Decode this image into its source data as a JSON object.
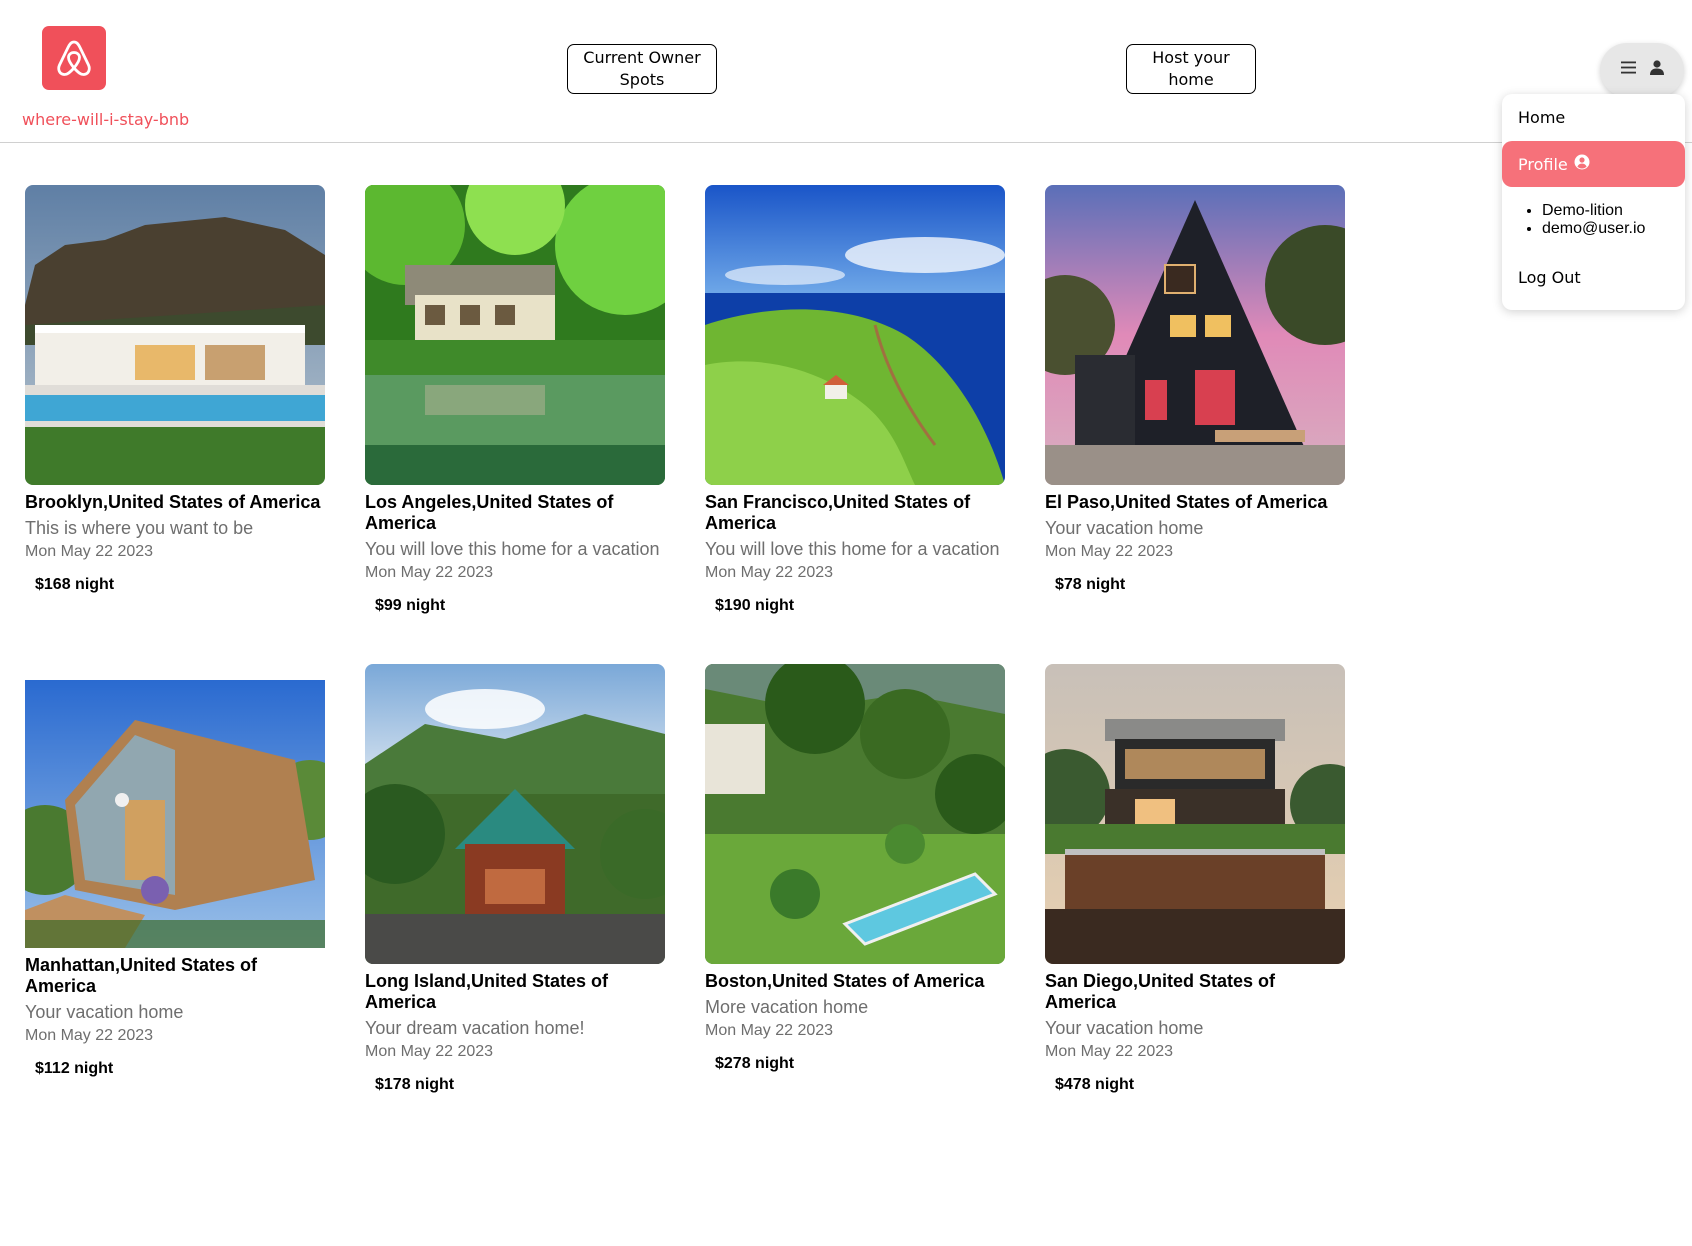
{
  "brand": {
    "site_name": "where-will-i-stay-bnb",
    "logo_icon": "airbnb-belo-icon",
    "accent": "#f0505a"
  },
  "header": {
    "owner_spots_label": "Current Owner Spots",
    "host_label": "Host your home",
    "menu_icon": "hamburger-icon",
    "user_icon": "user-icon"
  },
  "dropdown": {
    "home": "Home",
    "profile": "Profile",
    "profile_icon": "user-circle-icon",
    "username": "Demo-lition",
    "email": "demo@user.io",
    "logout": "Log Out",
    "highlight": "#f6717a"
  },
  "spots": [
    {
      "city": "Brooklyn,United States of America",
      "description": "This is where you want to be",
      "date": "Mon May 22 2023",
      "price": "$168 night",
      "image": "modern-villa-pool-mountain"
    },
    {
      "city": "Los Angeles,United States of America",
      "description": "You will love this home for a vacation",
      "date": "Mon May 22 2023",
      "price": "$99 night",
      "image": "house-by-pond-forest"
    },
    {
      "city": "San Francisco,United States of America",
      "description": "You will love this home for a vacation",
      "date": "Mon May 22 2023",
      "price": "$190 night",
      "image": "cliff-ocean-house"
    },
    {
      "city": "El Paso,United States of America",
      "description": "Your vacation home",
      "date": "Mon May 22 2023",
      "price": "$78 night",
      "image": "a-frame-cabin-lights"
    },
    {
      "city": "Manhattan,United States of America",
      "description": "Your vacation home",
      "date": "Mon May 22 2023",
      "price": "$112 night",
      "image": "glass-pod-cabin"
    },
    {
      "city": "Long Island,United States of America",
      "description": "Your dream vacation home!",
      "date": "Mon May 22 2023",
      "price": "$178 night",
      "image": "log-cabin-mountains"
    },
    {
      "city": "Boston,United States of America",
      "description": "More vacation home",
      "date": "Mon May 22 2023",
      "price": "$278 night",
      "image": "garden-villa-pool"
    },
    {
      "city": "San Diego,United States of America",
      "description": "Your vacation home",
      "date": "Mon May 22 2023",
      "price": "$478 night",
      "image": "modern-house-deck"
    }
  ]
}
